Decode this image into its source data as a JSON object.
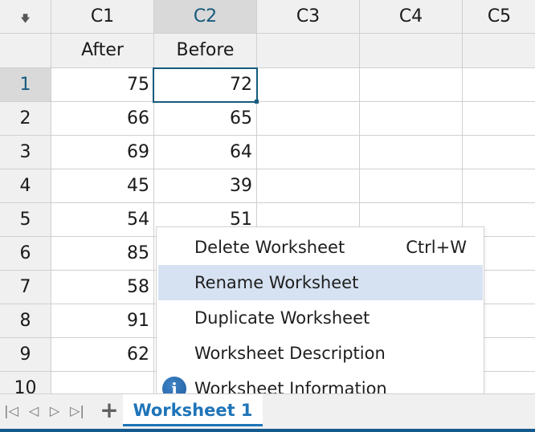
{
  "worksheet": {
    "column_headers": [
      "C1",
      "C2",
      "C3",
      "C4",
      "C5"
    ],
    "selected_column": "C2",
    "column_names": [
      "After",
      "Before",
      "",
      "",
      ""
    ],
    "rows": [
      {
        "row": "1",
        "values": [
          "75",
          "72"
        ]
      },
      {
        "row": "2",
        "values": [
          "66",
          "65"
        ]
      },
      {
        "row": "3",
        "values": [
          "69",
          "64"
        ]
      },
      {
        "row": "4",
        "values": [
          "45",
          "39"
        ]
      },
      {
        "row": "5",
        "values": [
          "54",
          "51"
        ]
      },
      {
        "row": "6",
        "values": [
          "85",
          ""
        ]
      },
      {
        "row": "7",
        "values": [
          "58",
          ""
        ]
      },
      {
        "row": "8",
        "values": [
          "91",
          ""
        ]
      },
      {
        "row": "9",
        "values": [
          "62",
          ""
        ]
      },
      {
        "row": "10",
        "values": [
          "",
          ""
        ]
      }
    ],
    "active_cell": {
      "row": "1",
      "column": "C2"
    },
    "corner_icon": "down-arrow-icon"
  },
  "context_menu": {
    "items": [
      {
        "label": "Delete Worksheet",
        "shortcut": "Ctrl+W",
        "icon": ""
      },
      {
        "label": "Rename Worksheet",
        "shortcut": "",
        "icon": "",
        "highlighted": true
      },
      {
        "label": "Duplicate Worksheet",
        "shortcut": "",
        "icon": ""
      },
      {
        "label": "Worksheet Description",
        "shortcut": "",
        "icon": ""
      },
      {
        "label": "Worksheet Information",
        "shortcut": "",
        "icon": "info-icon"
      }
    ]
  },
  "tabbar": {
    "nav_buttons": [
      "first-sheet",
      "previous-sheet",
      "next-sheet",
      "last-sheet"
    ],
    "add_label": "+",
    "active_tab": "Worksheet 1"
  },
  "colors": {
    "accent": "#155a7d",
    "tab_text": "#1e74b8",
    "menu_highlight": "#d6e2f2",
    "header_bg": "#f0f0f0"
  }
}
